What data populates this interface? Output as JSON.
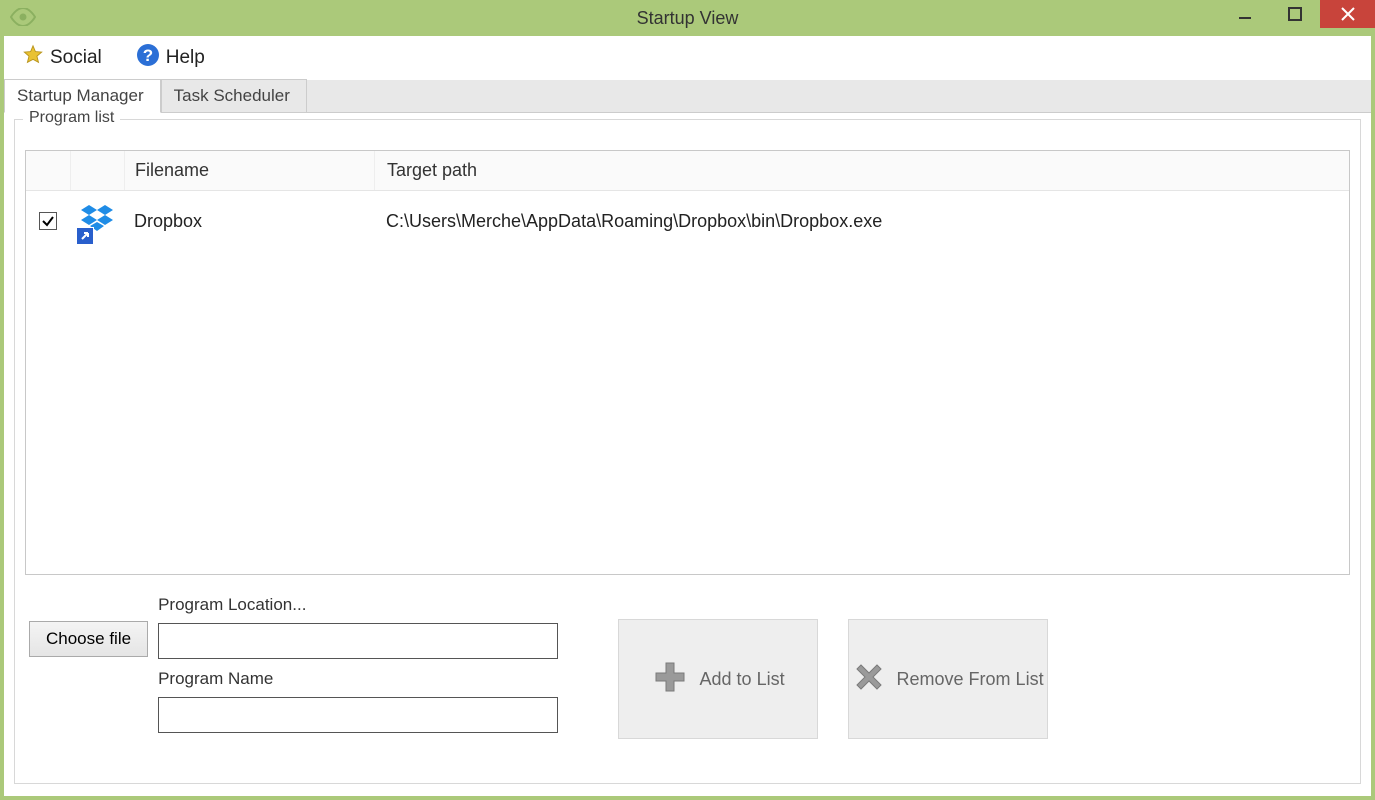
{
  "window": {
    "title": "Startup View"
  },
  "toolbar": {
    "social_label": "Social",
    "help_label": "Help"
  },
  "tabs": {
    "startup_manager": "Startup Manager",
    "task_scheduler": "Task Scheduler"
  },
  "group": {
    "legend": "Program list"
  },
  "columns": {
    "filename": "Filename",
    "target": "Target path"
  },
  "rows": [
    {
      "checked": true,
      "icon": "dropbox-icon",
      "filename": "Dropbox",
      "target": "C:\\Users\\Merche\\AppData\\Roaming\\Dropbox\\bin\\Dropbox.exe"
    }
  ],
  "form": {
    "choose_file": "Choose file",
    "program_location_label": "Program Location...",
    "program_location_value": "",
    "program_name_label": "Program Name",
    "program_name_value": "",
    "add_to_list": "Add to List",
    "remove_from_list": "Remove From List"
  }
}
